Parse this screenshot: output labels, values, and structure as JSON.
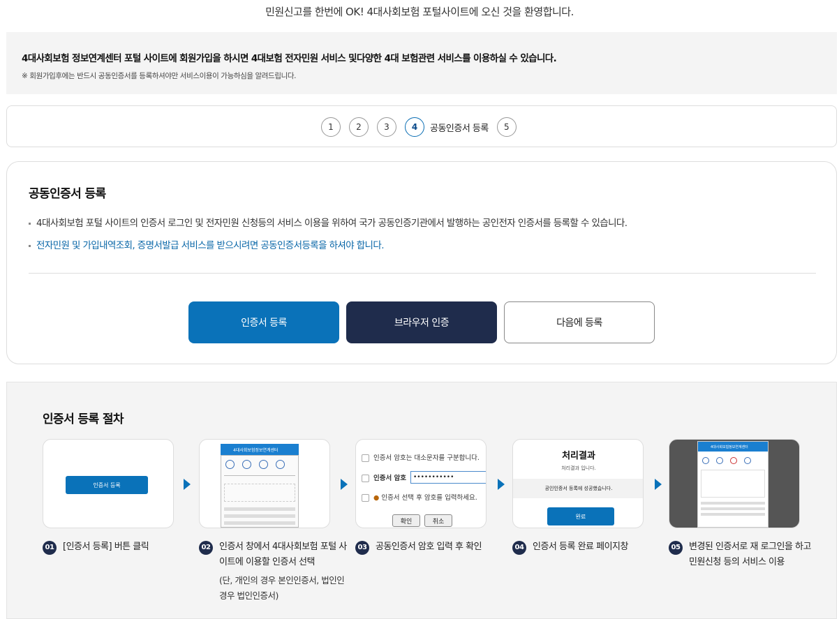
{
  "header": {
    "welcome": "민원신고를 한번에 OK! 4대사회보험 포털사이트에 오신 것을 환영합니다."
  },
  "notice": {
    "main": "4대사회보험 정보연계센터 포털 사이트에 회원가입을 하시면 4대보험 전자민원 서비스 및다양한 4대 보험관련 서비스를 이용하실 수 있습니다.",
    "sub": "※ 회원가입후에는 반드시 공동인증서를 등록하셔야만 서비스이용이 가능하심을 알려드립니다."
  },
  "steps": {
    "items": [
      "1",
      "2",
      "3",
      "4",
      "5"
    ],
    "active_label": "공동인증서 등록"
  },
  "card": {
    "title": "공동인증서 등록",
    "bullet1": "4대사회보험 포털 사이트의 인증서 로그인 및 전자민원 신청등의 서비스 이용을 위하여 국가 공동인증기관에서 발행하는 공인전자 인증서를 등록할 수 있습니다.",
    "bullet2": "전자민원 및 가입내역조회, 증명서발급 서비스를 받으시려면 공동인증서등록을 하셔야 합니다.",
    "buttons": {
      "register": "인증서 등록",
      "browser": "브라우저 인증",
      "later": "다음에 등록"
    }
  },
  "procedure": {
    "title": "인증서 등록 절차",
    "steps": [
      {
        "num": "01",
        "text": "[인증서 등록] 버튼 클릭",
        "note": ""
      },
      {
        "num": "02",
        "text": "인증서 창에서 4대사회보험 포털 사이트에 이용할 인증서 선택",
        "note": "(단, 개인의 경우 본인인증서, 법인인경우 법인인증서)"
      },
      {
        "num": "03",
        "text": "공동인증서 암호 입력 후 확인",
        "note": ""
      },
      {
        "num": "04",
        "text": "인증서 등록 완료 페이지창",
        "note": ""
      },
      {
        "num": "05",
        "text": "변경된 인증서로 재 로그인을 하고 민원신청 등의 서비스 이용",
        "note": ""
      }
    ],
    "thumb1": {
      "button": "인증서 등록"
    },
    "thumb2": {
      "title": "4대사회보험정보연계센터"
    },
    "thumb3": {
      "line1": "인증서 암호는 대소문자를 구분합니다.",
      "pw_label": "인증서 암호",
      "pw_value": "•••••••••••",
      "line3": "인증서 선택 후 암호를 입력하세요.",
      "ok": "확인",
      "cancel": "취소"
    },
    "thumb4": {
      "title": "처리결과",
      "sub": "처리결과 입니다.",
      "message": "공인인증서 등록에 성공했습니다.",
      "button": "완료"
    },
    "thumb5": {
      "title": "4대사회보험정보연계센터"
    }
  },
  "colors": {
    "primary": "#0a72b9",
    "navy": "#1f2c4c",
    "link": "#0a67a8"
  }
}
